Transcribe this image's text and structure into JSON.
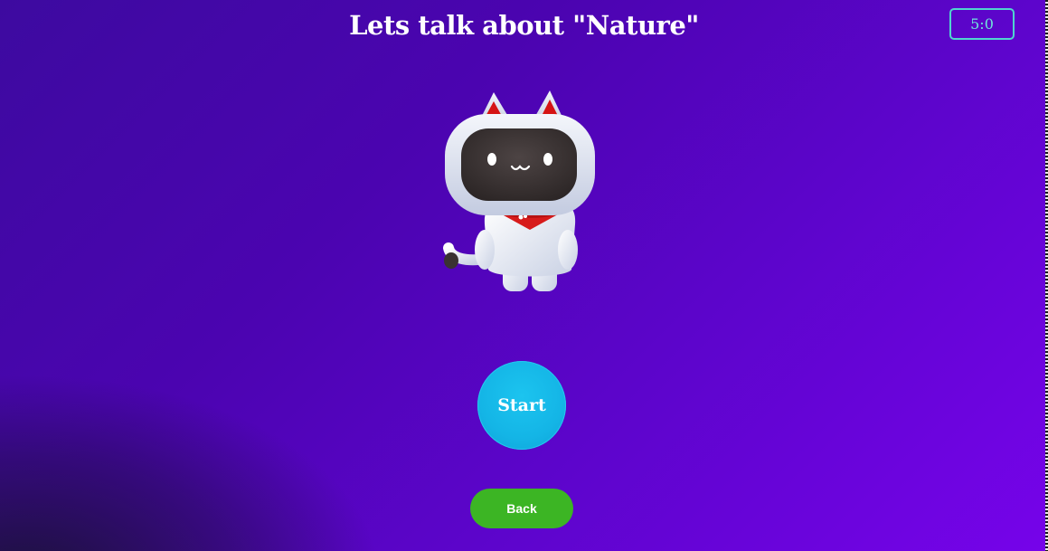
{
  "header": {
    "title": "Lets talk about \"Nature\""
  },
  "timer": {
    "value": "5:0"
  },
  "mascot": {
    "icon": "robot-cat-icon"
  },
  "actions": {
    "start_label": "Start",
    "back_label": "Back"
  },
  "colors": {
    "background_start": "#3d0aa0",
    "background_end": "#7603ea",
    "start_button": "#14b5e6",
    "back_button": "#3cb524",
    "timer_border": "#4fd6cf"
  }
}
